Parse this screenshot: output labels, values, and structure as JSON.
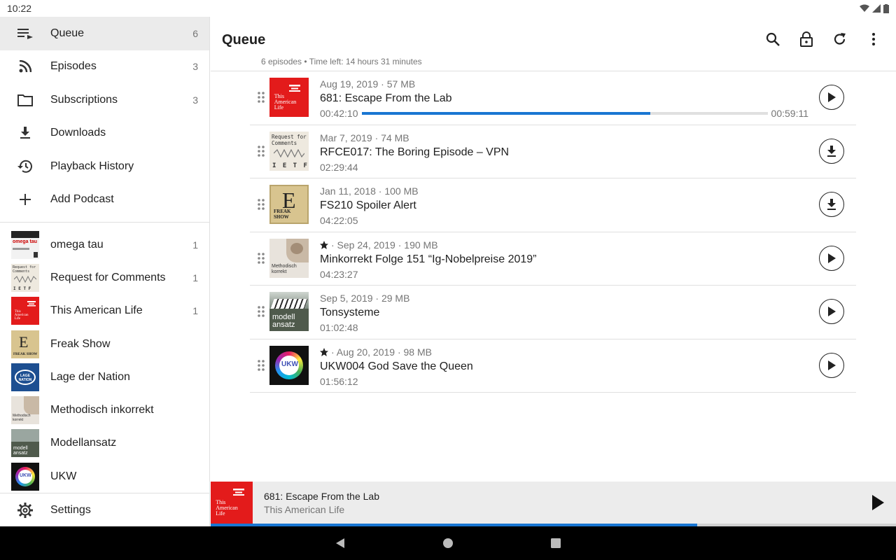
{
  "status": {
    "time": "10:22"
  },
  "drawer": {
    "nav": [
      {
        "label": "Queue",
        "count": "6",
        "icon": "queue-icon"
      },
      {
        "label": "Episodes",
        "count": "3",
        "icon": "rss-icon"
      },
      {
        "label": "Subscriptions",
        "count": "3",
        "icon": "folder-icon"
      },
      {
        "label": "Downloads",
        "count": "",
        "icon": "download-icon"
      },
      {
        "label": "Playback History",
        "count": "",
        "icon": "history-icon"
      },
      {
        "label": "Add Podcast",
        "count": "",
        "icon": "plus-icon"
      }
    ],
    "subscriptions": [
      {
        "label": "omega tau",
        "count": "1"
      },
      {
        "label": "Request for Comments",
        "count": "1"
      },
      {
        "label": "This American Life",
        "count": "1"
      },
      {
        "label": "Freak Show",
        "count": ""
      },
      {
        "label": "Lage der Nation",
        "count": ""
      },
      {
        "label": "Methodisch inkorrekt",
        "count": ""
      },
      {
        "label": "Modellansatz",
        "count": ""
      },
      {
        "label": "UKW",
        "count": ""
      }
    ],
    "settings_label": "Settings"
  },
  "main": {
    "title": "Queue",
    "subtitle": "6 episodes • Time left: 14 hours 31 minutes",
    "episodes": [
      {
        "meta": "Aug 19, 2019 · 57 MB",
        "title": "681: Escape From the Lab",
        "position": "00:42:10",
        "duration": "00:59:11",
        "progress": 0.71,
        "action": "play",
        "favorite": false
      },
      {
        "meta": "Mar 7, 2019 · 74 MB",
        "title": "RFCE017: The Boring Episode – VPN",
        "position": "02:29:44",
        "duration": "",
        "progress": null,
        "action": "download",
        "favorite": false
      },
      {
        "meta": "Jan 11, 2018 · 100 MB",
        "title": "FS210 Spoiler Alert",
        "position": "04:22:05",
        "duration": "",
        "progress": null,
        "action": "download",
        "favorite": false
      },
      {
        "meta": "· Sep 24, 2019 · 190 MB",
        "title": "Minkorrekt Folge 151 “Ig-Nobelpreise 2019”",
        "position": "04:23:27",
        "duration": "",
        "progress": null,
        "action": "play",
        "favorite": true
      },
      {
        "meta": "Sep 5, 2019 · 29 MB",
        "title": "Tonsysteme",
        "position": "01:02:48",
        "duration": "",
        "progress": null,
        "action": "play",
        "favorite": false
      },
      {
        "meta": "· Aug 20, 2019 · 98 MB",
        "title": "UKW004 God Save the Queen",
        "position": "01:56:12",
        "duration": "",
        "progress": null,
        "action": "play",
        "favorite": true
      }
    ]
  },
  "player": {
    "title": "681: Escape From the Lab",
    "podcast": "This American Life",
    "progress": 0.71
  },
  "art": {
    "tal": "This American Life",
    "rfc_top": "Request for Comments",
    "rfc_bottom": "I E T F",
    "freak": "FREAK SHOW",
    "lage": "LAGE NATION",
    "meth": "Methodisch korrekt",
    "model": "modell ansatz",
    "ukw": "UKW",
    "omega": "omega tau"
  },
  "colors": {
    "accent": "#1976d2",
    "tal_red": "#e31b1b"
  }
}
